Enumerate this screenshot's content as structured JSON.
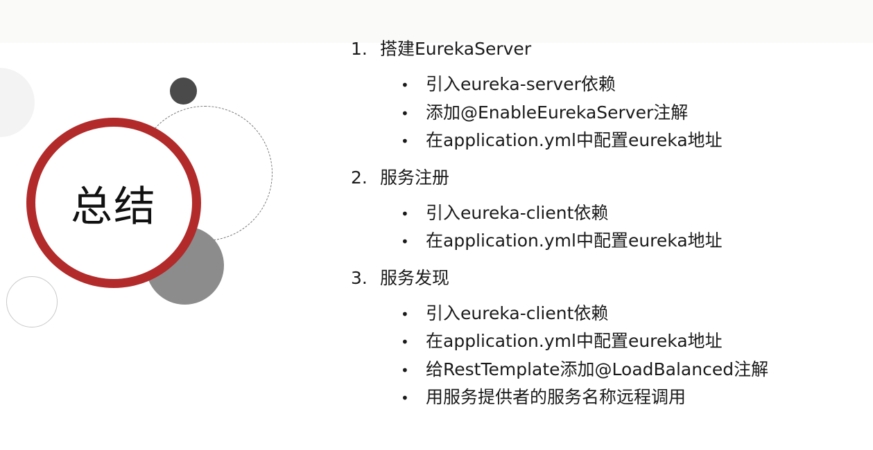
{
  "slide": {
    "title": "总结",
    "sections": [
      {
        "number": "1.",
        "heading": "搭建EurekaServer",
        "bullets": [
          "引入eureka-server依赖",
          "添加@EnableEurekaServer注解",
          "在application.yml中配置eureka地址"
        ]
      },
      {
        "number": "2.",
        "heading": "服务注册",
        "bullets": [
          "引入eureka-client依赖",
          "在application.yml中配置eureka地址"
        ]
      },
      {
        "number": "3.",
        "heading": "服务发现",
        "bullets": [
          "引入eureka-client依赖",
          "在application.yml中配置eureka地址",
          "给RestTemplate添加@LoadBalanced注解",
          "用服务提供者的服务名称远程调用"
        ]
      }
    ],
    "bullet_glyph": "•"
  },
  "colors": {
    "ring": "#b22a2a",
    "dark_dot": "#4a4a4a",
    "gray_circle": "#8c8c8c"
  }
}
